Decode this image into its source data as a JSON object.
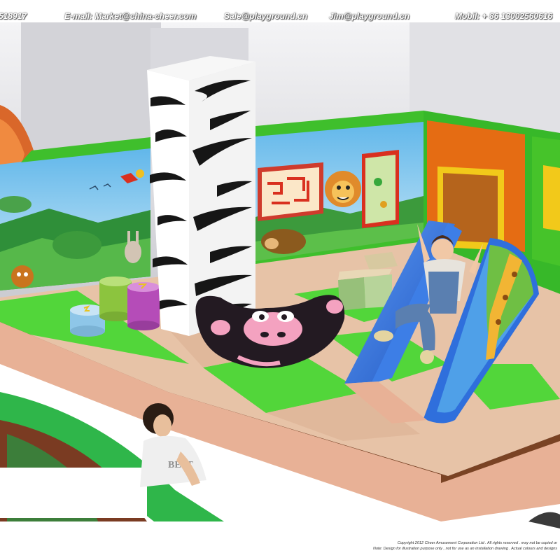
{
  "contact": {
    "phone_tail": "518917",
    "email_market": "E-mail: Market@china-cheer.com",
    "email_sale": "Sale@playground.cn",
    "email_jim": "Jim@playground.cn",
    "mobile": "Mobil: + 86 13002560616"
  },
  "footer": {
    "copyright": "Copyright 2012 Cheer Amusement Corporation Ltd . All rights reserved . may not be copied or",
    "note": "Note: Design for illustration purpose only , not for use as an installation drawing . Actual colours and designs"
  },
  "colors": {
    "green_pad": "#52d63a",
    "wall_sky": "#7fc9ef",
    "floor_tan": "#e7c3a7",
    "slide_blue": "#2f6fdc",
    "rocker_black": "#231a22"
  }
}
